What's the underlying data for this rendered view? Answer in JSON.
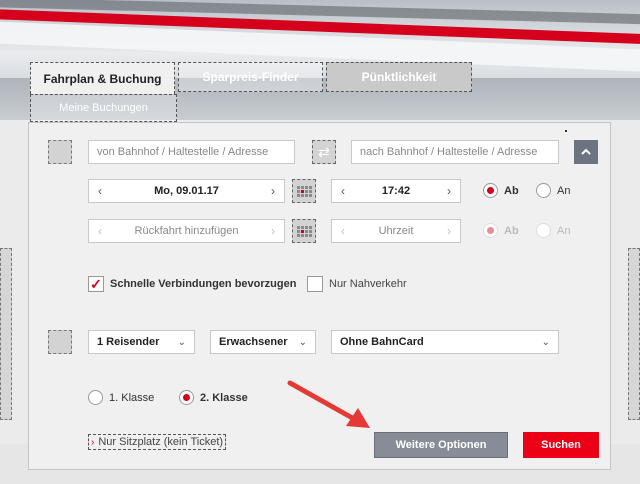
{
  "tabs": {
    "fahrplan": "Fahrplan & Buchung",
    "sparpreis": "Sparpreis-Finder",
    "puenktlichkeit": "Pünktlichkeit",
    "buchungen": "Meine Buchungen"
  },
  "route": {
    "from_placeholder": "von  Bahnhof / Haltestelle / Adresse",
    "to_placeholder": "nach  Bahnhof / Haltestelle / Adresse"
  },
  "outbound": {
    "date": "Mo, 09.01.17",
    "time": "17:42",
    "ab_label": "Ab",
    "an_label": "An"
  },
  "return": {
    "date": "Rückfahrt hinzufügen",
    "time": "Uhrzeit",
    "ab_label": "Ab",
    "an_label": "An"
  },
  "options": {
    "fast_connections": "Schnelle Verbindungen bevorzugen",
    "local_only": "Nur Nahverkehr"
  },
  "travellers": {
    "count": "1 Reisender",
    "type": "Erwachsener",
    "bahncard": "Ohne BahnCard"
  },
  "classes": {
    "first": "1. Klasse",
    "second": "2. Klasse"
  },
  "seat_only": "Nur Sitzplatz (kein Ticket)",
  "buttons": {
    "more_options": "Weitere Optionen",
    "search": "Suchen"
  },
  "colors": {
    "accent": "#ec0016",
    "button_gray": "#878c96",
    "annotation_arrow": "#e53935"
  }
}
